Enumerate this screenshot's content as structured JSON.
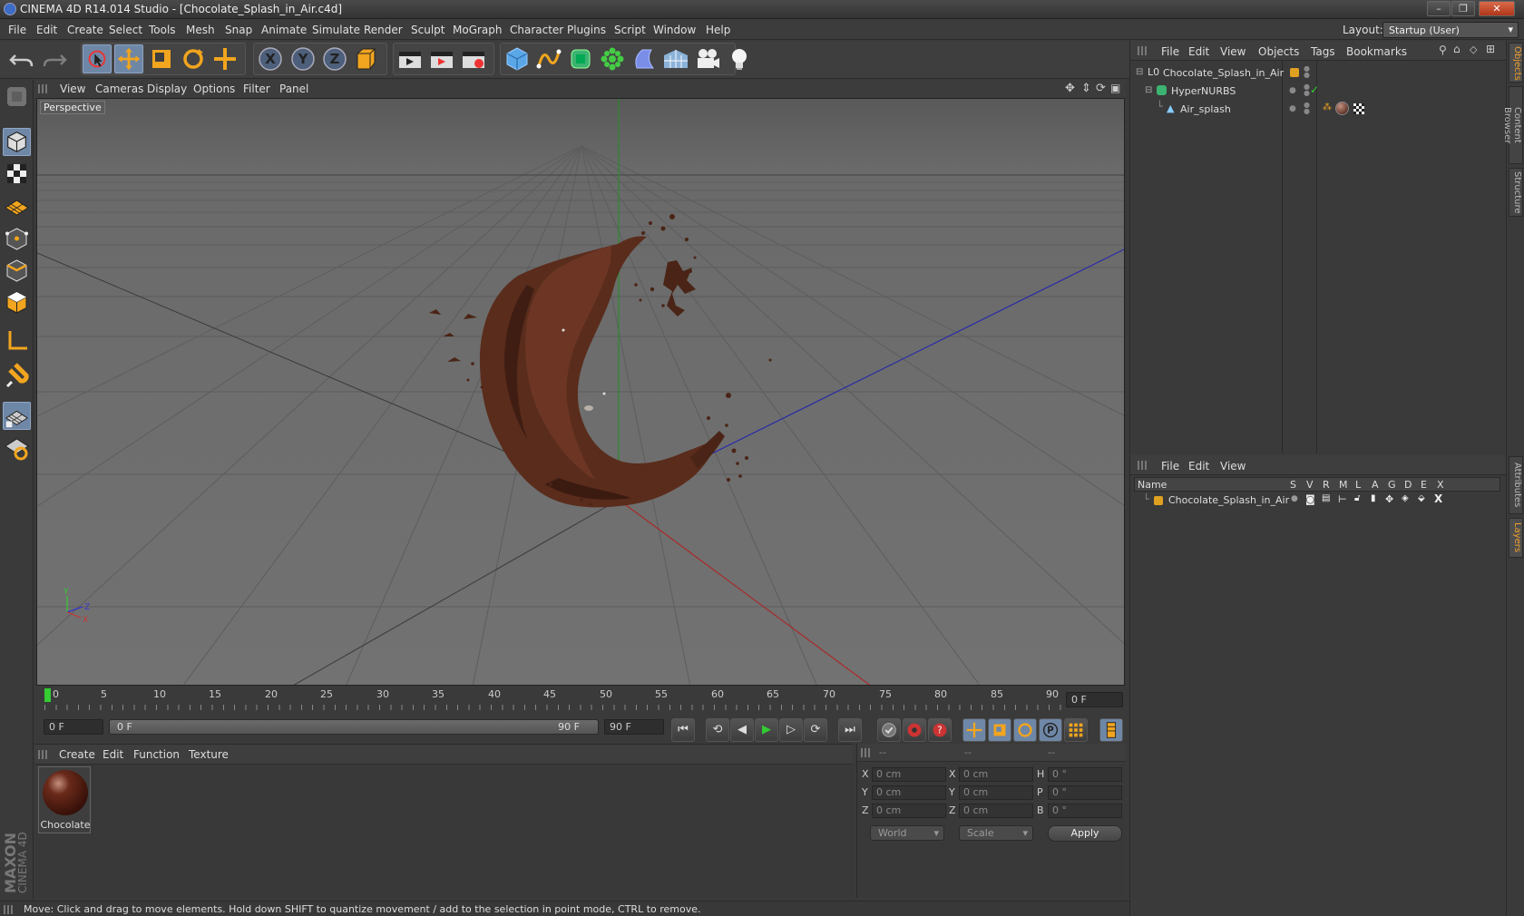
{
  "window": {
    "title": "CINEMA 4D R14.014 Studio - [Chocolate_Splash_in_Air.c4d]",
    "buttons": [
      "–",
      "❐",
      "✕"
    ]
  },
  "menubar": {
    "items": [
      "File",
      "Edit",
      "Create",
      "Select",
      "Tools",
      "Mesh",
      "Snap",
      "Animate",
      "Simulate",
      "Render",
      "Sculpt",
      "MoGraph",
      "Character",
      "Plugins",
      "Script",
      "Window",
      "Help"
    ],
    "layout_label": "Layout:",
    "layout_value": "Startup (User)"
  },
  "toolbar": {
    "icons": [
      "undo-icon",
      "redo-icon",
      "live-selection-icon",
      "move-icon",
      "scale-icon",
      "rotate-icon",
      "recent-tool-icon",
      "x-axis-icon",
      "y-axis-icon",
      "z-axis-icon",
      "coordinate-system-icon",
      "render-view-icon",
      "render-picture-viewer-icon",
      "render-settings-icon",
      "cube-icon",
      "spline-icon",
      "nurbs-icon",
      "array-icon",
      "deformer-icon",
      "scene-icon",
      "camera-icon",
      "light-icon"
    ],
    "axis_labels": [
      "X",
      "Y",
      "Z"
    ]
  },
  "left_toolbar": {
    "icons": [
      "make-editable-icon",
      "model-mode-icon",
      "texture-mode-icon",
      "workplane-mode-icon",
      "points-mode-icon",
      "edges-mode-icon",
      "polygons-mode-icon",
      "axis-mode-icon",
      "tweak-mode-icon",
      "snap-icon",
      "locked-workplane-icon"
    ]
  },
  "viewport": {
    "menu": [
      "View",
      "Cameras",
      "Display",
      "Options",
      "Filter",
      "Panel"
    ],
    "label": "Perspective",
    "axes_gizmo": {
      "x": "X",
      "y": "Y",
      "z": "Z"
    }
  },
  "timeline": {
    "ticks": [
      "0",
      "5",
      "10",
      "15",
      "20",
      "25",
      "30",
      "35",
      "40",
      "45",
      "50",
      "55",
      "60",
      "65",
      "70",
      "75",
      "80",
      "85",
      "90"
    ],
    "current_frame": "0 F"
  },
  "transport": {
    "start_field": "0 F",
    "range_start": "0 F",
    "range_end": "90 F",
    "end_field": "90 F",
    "buttons": [
      "⏮",
      "⟲",
      "◀",
      "▶",
      "▷",
      "⟳",
      "⏭"
    ]
  },
  "material_manager": {
    "menu": [
      "Create",
      "Edit",
      "Function",
      "Texture"
    ],
    "materials": [
      {
        "name": "Chocolate"
      }
    ]
  },
  "coordinates": {
    "headers": [
      "--",
      "--",
      "--"
    ],
    "rows": [
      {
        "l1": "X",
        "v1": "0 cm",
        "l2": "X",
        "v2": "0 cm",
        "l3": "H",
        "v3": "0 °"
      },
      {
        "l1": "Y",
        "v1": "0 cm",
        "l2": "Y",
        "v2": "0 cm",
        "l3": "P",
        "v3": "0 °"
      },
      {
        "l1": "Z",
        "v1": "0 cm",
        "l2": "Z",
        "v2": "0 cm",
        "l3": "B",
        "v3": "0 °"
      }
    ],
    "mode1": "World",
    "mode2": "Scale",
    "apply": "Apply"
  },
  "status": {
    "text": "Move: Click and drag to move elements. Hold down SHIFT to quantize movement / add to the selection in point mode, CTRL to remove."
  },
  "object_manager": {
    "menu": [
      "File",
      "Edit",
      "View",
      "Objects",
      "Tags",
      "Bookmarks"
    ],
    "objects": [
      {
        "name": "Chocolate_Splash_in_Air"
      },
      {
        "name": "HyperNURBS"
      },
      {
        "name": "Air_splash"
      }
    ]
  },
  "layer_manager": {
    "menu": [
      "File",
      "Edit",
      "View"
    ],
    "columns": [
      "Name",
      "S",
      "V",
      "R",
      "M",
      "L",
      "A",
      "G",
      "D",
      "E",
      "X"
    ],
    "layers": [
      {
        "name": "Chocolate_Splash_in_Air",
        "color": "#e0a020"
      }
    ]
  },
  "right_tabs": [
    "Objects",
    "Content Browser",
    "Structure",
    "Attributes",
    "Layers"
  ],
  "branding": {
    "maxon": "MAXON",
    "product": "CINEMA 4D"
  },
  "colors": {
    "accent": "#6f87a6",
    "selected_tab": "#f0a030",
    "chocolate": "#5a2a18"
  }
}
